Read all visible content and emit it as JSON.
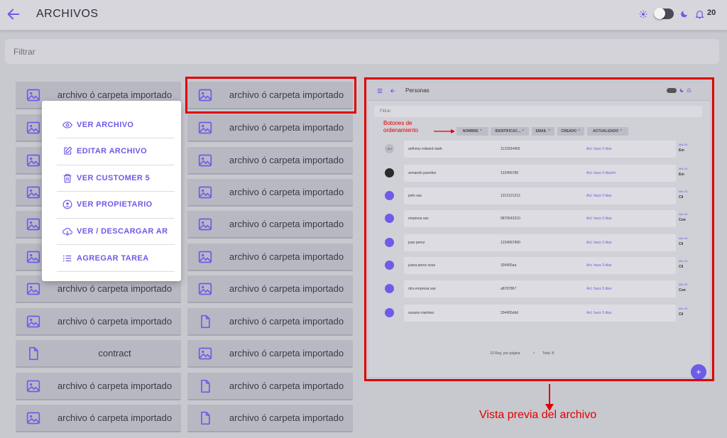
{
  "header": {
    "title": "ARCHIVOS",
    "notifications": "20"
  },
  "filter": {
    "placeholder": "Filtrar"
  },
  "files": [
    [
      "archivo ó carpeta importado",
      "image-icon"
    ],
    [
      "archivo ó carpeta importado",
      "image-icon"
    ],
    [
      "archivo ó carpeta importado",
      "image-icon"
    ],
    [
      "archivo ó carpeta importado",
      "image-icon"
    ],
    [
      "archivo ó carpeta importado",
      "image-icon"
    ],
    [
      "archivo ó carpeta importado",
      "image-icon"
    ],
    [
      "archivo ó carpeta importado",
      "image-icon"
    ],
    [
      "archivo ó carpeta importado",
      "image-icon"
    ],
    [
      "archivo ó carpeta importado",
      "image-icon"
    ],
    [
      "archivo ó carpeta importado",
      "image-icon"
    ],
    [
      "archivo ó carpeta importado",
      "image-icon"
    ],
    [
      "archivo ó carpeta importado",
      "image-icon"
    ],
    [
      "archivo ó carpeta importado",
      "image-icon"
    ],
    [
      "archivo ó carpeta importado",
      "image-icon"
    ],
    [
      "archivo ó carpeta importado",
      "image-icon"
    ],
    [
      "archivo ó carpeta importado",
      "file-icon"
    ],
    [
      "contract",
      "file-icon"
    ],
    [
      "archivo ó carpeta importado",
      "image-icon"
    ],
    [
      "archivo ó carpeta importado",
      "image-icon"
    ],
    [
      "archivo ó carpeta importado",
      "file-icon"
    ],
    [
      "archivo ó carpeta importado",
      "image-icon"
    ],
    [
      "archivo ó carpeta importado",
      "file-icon"
    ]
  ],
  "menu": [
    {
      "label": "VER ARCHIVO",
      "icon": "eye-icon"
    },
    {
      "label": "EDITAR ARCHIVO",
      "icon": "edit-icon"
    },
    {
      "label": "VER CUSTOMER 5",
      "icon": "trash-icon"
    },
    {
      "label": "VER PROPIETARIO",
      "icon": "user-circle-icon"
    },
    {
      "label": "VER / DESCARGAR AR",
      "icon": "cloud-download-icon"
    },
    {
      "label": "AGREGAR TAREA",
      "icon": "list-icon"
    }
  ],
  "preview": {
    "title": "Personas",
    "filter": "Filtrar",
    "sort_note": "Botones de ordenamiento",
    "sort_buttons": [
      "NOMBRE",
      "IDENTIFICAC...",
      "EMAIL",
      "CREADO",
      "ACTUALIZADO"
    ],
    "rows": [
      {
        "initials": "JEJ",
        "name": "anthony edward stark",
        "id": "1123334455",
        "email": "Act. hace 3 dias",
        "date": "Mar 26",
        "type": "Em"
      },
      {
        "initials": "",
        "name": "armando paredes",
        "id": "123456789",
        "email": "Act. hace 3 dias/m",
        "date": "Mar 26",
        "type": "Em"
      },
      {
        "initials": "",
        "name": "pefo sas",
        "id": "1212121212",
        "email": "Act. hace 3 dias",
        "date": "Mar 26",
        "type": "Cli"
      },
      {
        "initials": "",
        "name": "empresa sas",
        "id": "9876543210",
        "email": "Act. hace 3 dias",
        "date": "Mar 26",
        "type": "Con"
      },
      {
        "initials": "",
        "name": "juan perez",
        "id": "1234567890",
        "email": "Act. hace 3 dias",
        "date": "Mar 26",
        "type": "Cli"
      },
      {
        "initials": "",
        "name": "juana perez sosa",
        "id": "334455aa",
        "email": "Act. hace 3 dias",
        "date": "Mar 26",
        "type": "Cli"
      },
      {
        "initials": "",
        "name": "otra empresa sas",
        "id": "a8787867",
        "email": "Act. hace 3 dias",
        "date": "Mar 26",
        "type": "Con"
      },
      {
        "initials": "",
        "name": "susana martinez",
        "id": "334455ddd",
        "email": "Act. hace 3 dias",
        "date": "Mar 26",
        "type": "Cli"
      }
    ],
    "footer_per_page": "10 Reg. por página",
    "footer_total": "Total: 8"
  },
  "caption": "Vista previa del archivo",
  "colors": {
    "accent": "#6c5ce7",
    "highlight": "#e00000"
  }
}
